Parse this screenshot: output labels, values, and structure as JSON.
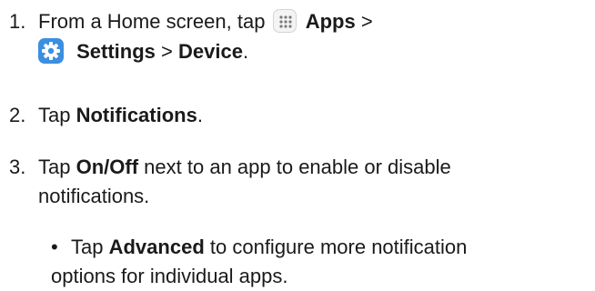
{
  "steps": [
    {
      "number": "1.",
      "line1": {
        "text_a": "From a Home screen, tap",
        "icon": "apps-grid-icon",
        "bold_a": "Apps",
        "text_b": ">"
      },
      "line2": {
        "icon": "settings-gear-icon",
        "bold_a": "Settings",
        "text_a": ">",
        "bold_b": "Device",
        "text_b": "."
      }
    },
    {
      "number": "2.",
      "text_a": "Tap",
      "bold_a": "Notifications",
      "text_b": "."
    },
    {
      "number": "3.",
      "text_a": "Tap",
      "bold_a": "On/Off",
      "text_b": "next to an app to enable or disable",
      "line2": "notifications."
    }
  ],
  "bullets": [
    {
      "marker": "•",
      "text_a": "Tap",
      "bold_a": "Advanced",
      "text_b": "to configure more notification",
      "line2": "options for individual apps."
    }
  ],
  "colors": {
    "text": "#1a1a1a",
    "settings_icon_bg": "#3b8fe0",
    "apps_icon_bg": "#f4f4f4"
  }
}
